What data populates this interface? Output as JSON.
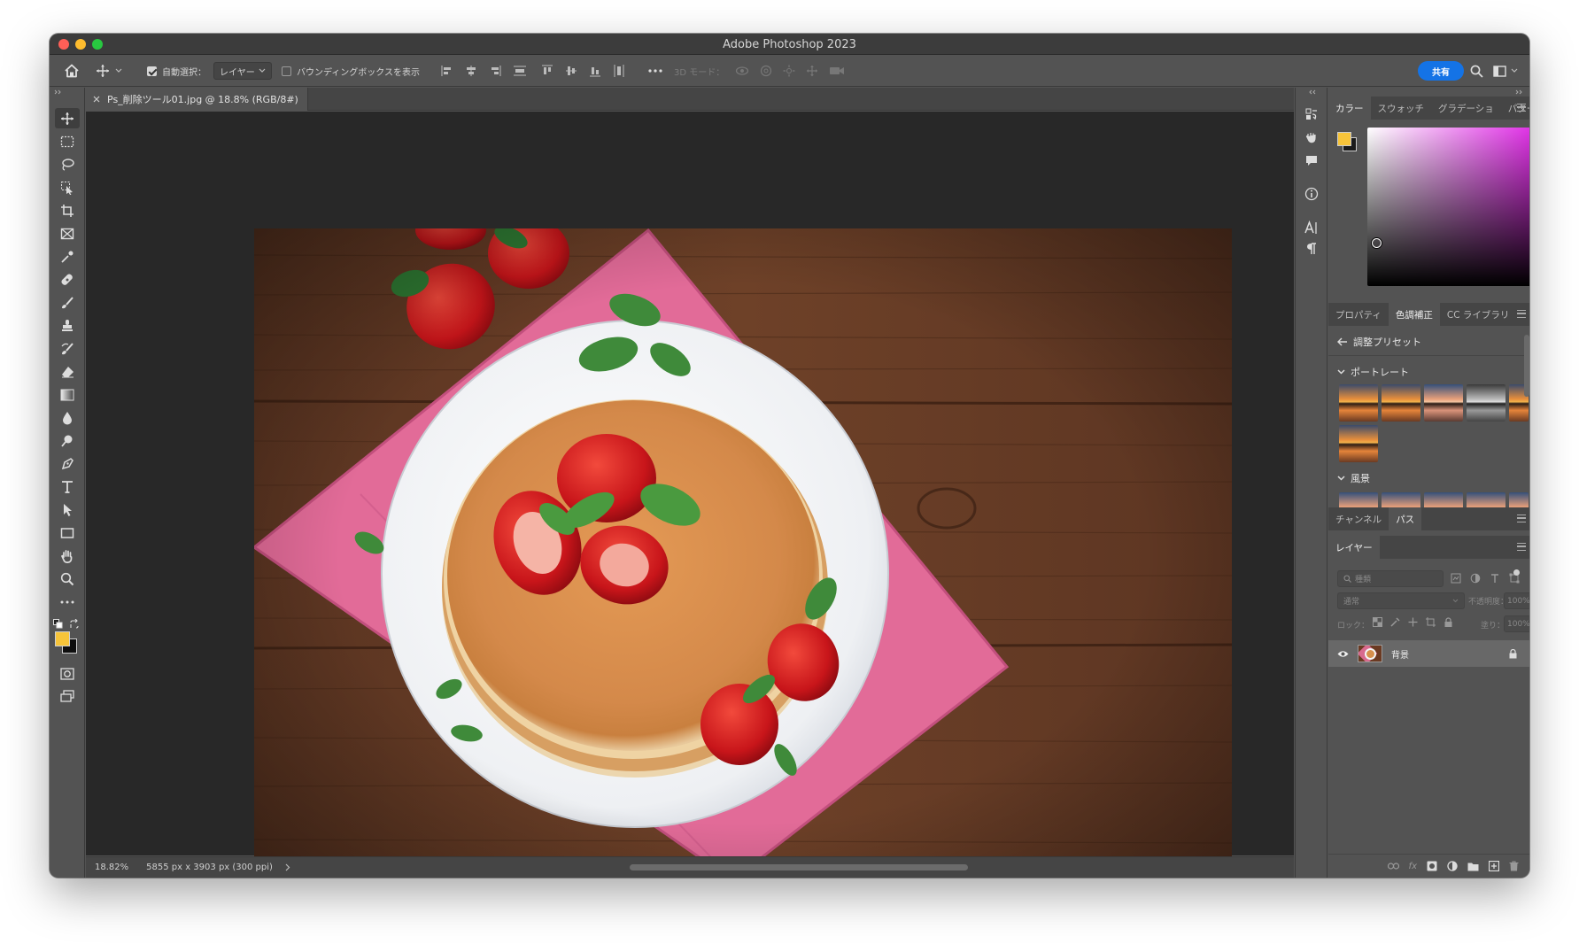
{
  "window": {
    "title": "Adobe Photoshop 2023"
  },
  "options_bar": {
    "auto_select_label": "自動選択：",
    "auto_select_value": "レイヤー",
    "bounding_box_label": "バウンディングボックスを表示",
    "three_d_mode_label": "3D モード：",
    "share_label": "共有"
  },
  "document": {
    "tab_title": "Ps_削除ツール01.jpg @ 18.8% (RGB/8#)",
    "status_zoom": "18.82%",
    "status_info": "5855 px x 3903 px (300 ppi)"
  },
  "color_panel": {
    "tabs": [
      "カラー",
      "スウォッチ",
      "グラデーショ",
      "パターン"
    ],
    "foreground_color": "#f7c43a",
    "background_color": "#1a1a1a"
  },
  "adjustments_panel": {
    "tabs": [
      "プロパティ",
      "色調補正",
      "CC ライブラリ"
    ],
    "back_label": "調整プリセット",
    "sections": [
      {
        "label": "ポートレート"
      },
      {
        "label": "風景"
      }
    ]
  },
  "paths_panel": {
    "tabs": [
      "チャンネル",
      "パス"
    ]
  },
  "layers_panel": {
    "tab": "レイヤー",
    "search_placeholder": "種類",
    "blend_mode": "通常",
    "opacity_label": "不透明度：",
    "opacity_value": "100%",
    "lock_label": "ロック：",
    "fill_label": "塗り：",
    "fill_value": "100%",
    "layers": [
      {
        "name": "背景",
        "visible": true,
        "locked": true
      }
    ]
  }
}
